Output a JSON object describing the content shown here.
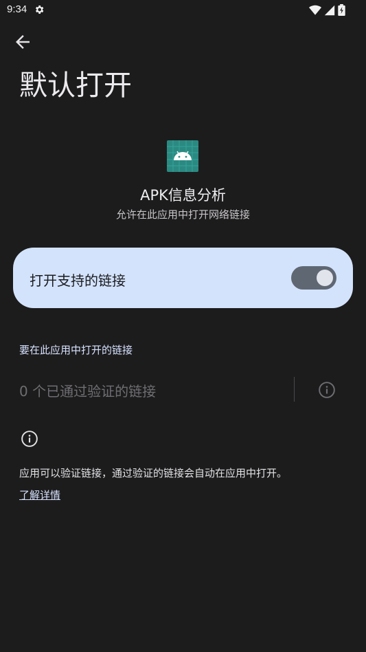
{
  "status_bar": {
    "time": "9:34"
  },
  "header": {
    "title": "默认打开"
  },
  "app": {
    "name": "APK信息分析",
    "subtitle": "允许在此应用中打开网络链接"
  },
  "toggle_card": {
    "label": "打开支持的链接",
    "checked": true
  },
  "links_section": {
    "header": "要在此应用中打开的链接",
    "verified_text": "0 个已通过验证的链接"
  },
  "footer": {
    "description": "应用可以验证链接，通过验证的链接会自动在应用中打开。",
    "learn_more": "了解详情"
  },
  "colors": {
    "background": "#1c1c1d",
    "card": "#d4e3fc",
    "switch_track": "#5f6773",
    "accent_text": "#d8e2ff"
  }
}
